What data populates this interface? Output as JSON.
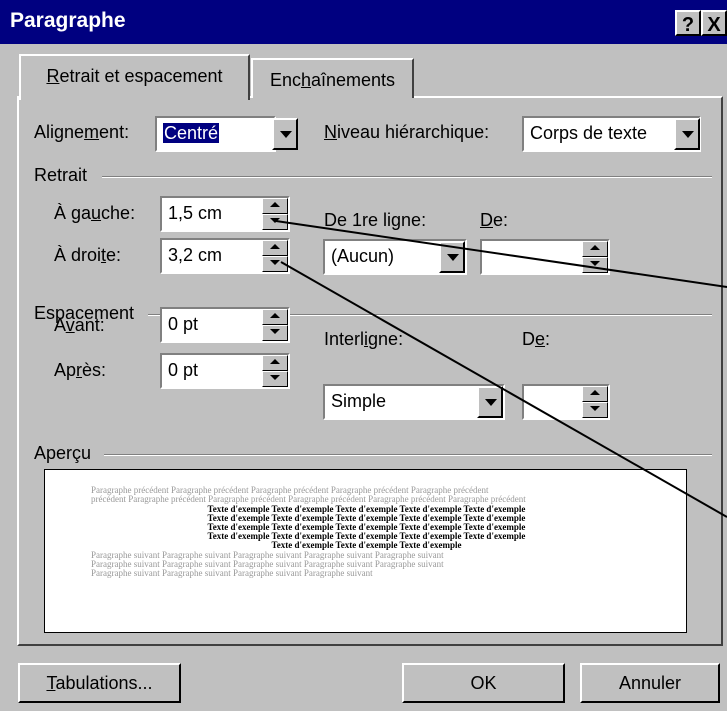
{
  "window": {
    "title": "Paragraphe",
    "help_label": "?",
    "close_label": "X"
  },
  "tabs": [
    {
      "label_pre": "",
      "label_u": "R",
      "label_post": "etrait et espacement"
    },
    {
      "label_pre": "Enc",
      "label_u": "h",
      "label_post": "aînements"
    }
  ],
  "alignement": {
    "label_pre": "Aligne",
    "label_u": "m",
    "label_post": "ent:",
    "value": "Centré"
  },
  "niveau": {
    "label_pre": "",
    "label_u": "N",
    "label_post": "iveau hiérarchique:",
    "value": "Corps de texte"
  },
  "retrait": {
    "heading": "Retrait",
    "gauche": {
      "label_pre": "À ga",
      "label_u": "u",
      "label_post": "che:",
      "value": "1,5 cm"
    },
    "droite": {
      "label_pre": "À droi",
      "label_u": "t",
      "label_post": "e:",
      "value": "3,2 cm"
    },
    "premiere": {
      "label_pre": "De 1re li",
      "label_u": "g",
      "label_post": "ne:",
      "value": "(Aucun)"
    },
    "de": {
      "label_pre": "",
      "label_u": "D",
      "label_post": "e:",
      "value": ""
    }
  },
  "espacement": {
    "heading": "Espacement",
    "avant": {
      "label_pre": "A",
      "label_u": "v",
      "label_post": "ant:",
      "value": "0 pt"
    },
    "apres": {
      "label_pre": "Ap",
      "label_u": "r",
      "label_post": "ès:",
      "value": "0 pt"
    },
    "interligne": {
      "label_pre": "Interl",
      "label_u": "i",
      "label_post": "gne:",
      "value": "Simple"
    },
    "de": {
      "label_pre": "D",
      "label_u": "e",
      "label_post": ":",
      "value": ""
    }
  },
  "apercu": {
    "heading": "Aperçu",
    "prev_lines": [
      "Paragraphe précédent Paragraphe précédent Paragraphe précédent Paragraphe précédent Paragraphe précédent",
      "précédent Paragraphe précédent Paragraphe précédent Paragraphe précédent Paragraphe précédent Paragraphe précédent"
    ],
    "text_lines": [
      "Texte d'exemple Texte d'exemple Texte d'exemple Texte d'exemple Texte d'exemple",
      "Texte d'exemple Texte d'exemple Texte d'exemple Texte d'exemple Texte d'exemple",
      "Texte d'exemple Texte d'exemple Texte d'exemple Texte d'exemple Texte d'exemple",
      "Texte d'exemple Texte d'exemple Texte d'exemple Texte d'exemple Texte d'exemple",
      "Texte d'exemple Texte d'exemple Texte d'exemple"
    ],
    "next_lines": [
      "Paragraphe suivant Paragraphe suivant Paragraphe suivant Paragraphe suivant Paragraphe suivant",
      "Paragraphe suivant Paragraphe suivant Paragraphe suivant Paragraphe suivant Paragraphe suivant",
      "Paragraphe suivant Paragraphe suivant Paragraphe suivant Paragraphe suivant"
    ]
  },
  "buttons": {
    "tabulations": {
      "label_pre": "",
      "label_u": "T",
      "label_post": "abulations..."
    },
    "ok": "OK",
    "annuler": "Annuler"
  },
  "colors": {
    "titlebar": "#000080",
    "dialog": "#c0c0c0",
    "selection": "#000080"
  }
}
